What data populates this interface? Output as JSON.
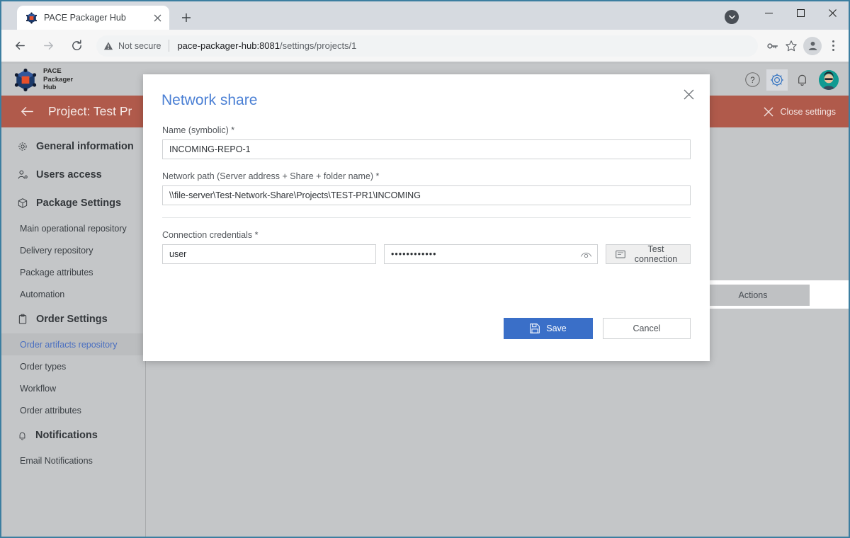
{
  "browser": {
    "tab": {
      "title": "PACE Packager Hub",
      "favicon": "cube-icon",
      "close": "×"
    },
    "new_tab": "+",
    "window_controls": {
      "minimize": "−",
      "maximize": "▢",
      "close": "✕"
    },
    "toolbar": {
      "back": "back-arrow-icon",
      "forward": "forward-arrow-icon",
      "reload": "reload-icon",
      "security_label": "Not secure",
      "url_host": "pace-packager-hub:8081",
      "url_path": "/settings/projects/1",
      "url_full": "pace-packager-hub:8081/settings/projects/1"
    }
  },
  "app": {
    "logo_line1": "PACE",
    "logo_line2": "Packager",
    "logo_line3": "Hub",
    "topbar_icons": [
      {
        "name": "help-icon",
        "glyph": "?"
      },
      {
        "name": "settings-gear-icon",
        "glyph": "gear"
      },
      {
        "name": "notifications-bell-icon",
        "glyph": "bell"
      },
      {
        "name": "user-avatar",
        "glyph": "avatar"
      }
    ],
    "project_title": "Project: Test Pr",
    "close_settings_label": "Close settings"
  },
  "sidebar": {
    "items": [
      {
        "label": "General information",
        "type": "group",
        "icon": "gear-icon",
        "selected": false
      },
      {
        "label": "Users access",
        "type": "group",
        "icon": "users-icon",
        "selected": false
      },
      {
        "label": "Package Settings",
        "type": "group",
        "icon": "cube-icon",
        "selected": false
      },
      {
        "label": "Main operational repository",
        "type": "sub",
        "selected": false
      },
      {
        "label": "Delivery repository",
        "type": "sub",
        "selected": false
      },
      {
        "label": "Package attributes",
        "type": "sub",
        "selected": false
      },
      {
        "label": "Automation",
        "type": "sub",
        "selected": false
      },
      {
        "label": "Order Settings",
        "type": "group",
        "icon": "clipboard-icon",
        "selected": false
      },
      {
        "label": "Order artifacts repository",
        "type": "sub",
        "selected": true
      },
      {
        "label": "Order types",
        "type": "sub",
        "selected": false
      },
      {
        "label": "Workflow",
        "type": "sub",
        "selected": false
      },
      {
        "label": "Order attributes",
        "type": "sub",
        "selected": false
      },
      {
        "label": "Notifications",
        "type": "group",
        "icon": "bell-icon",
        "selected": false
      },
      {
        "label": "Email Notifications",
        "type": "sub",
        "selected": false
      }
    ]
  },
  "content": {
    "actions_column_header": "Actions"
  },
  "modal": {
    "title": "Network share",
    "close_glyph": "✕",
    "name_field": {
      "label": "Name (symbolic) *",
      "value": "INCOMING-REPO-1",
      "placeholder": ""
    },
    "path_field": {
      "label": "Network path (Server address + Share + folder name) *",
      "value": "\\\\file-server\\Test-Network-Share\\Projects\\TEST-PR1\\INCOMING",
      "placeholder": ""
    },
    "credentials": {
      "label": "Connection credentials *",
      "username_value": "user",
      "username_placeholder": "",
      "password_value": "••••••••••••",
      "password_placeholder": "",
      "password_toggle_icon": "eye-icon",
      "test_connection_label": "Test connection",
      "test_connection_icon": "plug-icon"
    },
    "save_label": "Save",
    "save_icon": "floppy-disk-icon",
    "cancel_label": "Cancel"
  },
  "colors": {
    "accent_blue": "#3a6fc8",
    "title_blue": "#4a7fd4",
    "project_header": "#b05a4b",
    "app_bg": "#c4c6c8",
    "selected_nav_text": "#4a6fc0"
  }
}
